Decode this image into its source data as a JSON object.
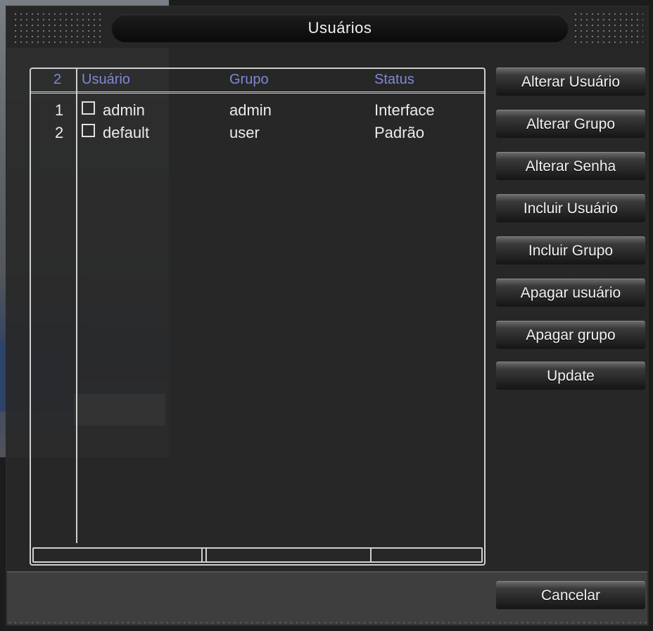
{
  "window": {
    "title": "Usuários"
  },
  "table": {
    "count_header": "2",
    "columns": [
      "Usuário",
      "Grupo",
      "Status"
    ],
    "rows": [
      {
        "index": "1",
        "user": "admin",
        "group": "admin",
        "status": "Interface"
      },
      {
        "index": "2",
        "user": "default",
        "group": "user",
        "status": "Padrão"
      }
    ]
  },
  "actions": {
    "alterar_usuario": "Alterar Usuário",
    "alterar_grupo": "Alterar Grupo",
    "alterar_senha": "Alterar Senha",
    "incluir_usuario": "Incluir Usuário",
    "incluir_grupo": "Incluir Grupo",
    "apagar_usuario": "Apagar usuário",
    "apagar_grupo": "Apagar grupo",
    "update": "Update"
  },
  "footer": {
    "cancelar": "Cancelar"
  },
  "colors": {
    "header_text": "#7f89d6",
    "panel_bg": "#282828",
    "text": "#ececec"
  }
}
